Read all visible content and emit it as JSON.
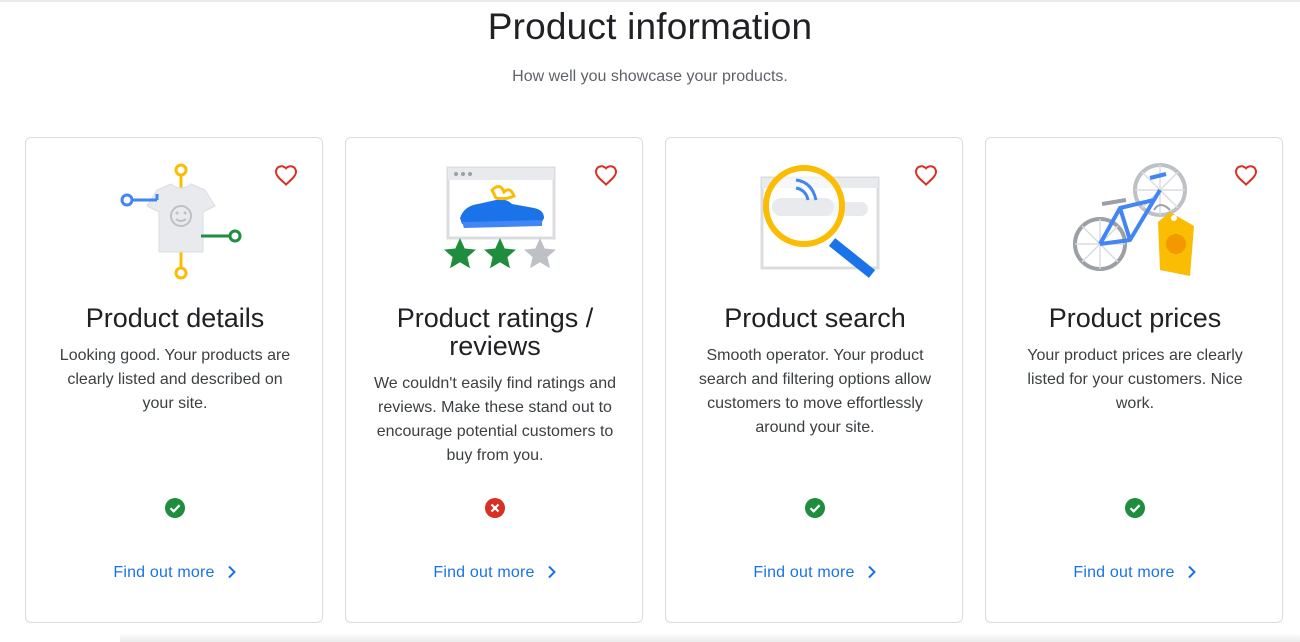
{
  "page": {
    "title": "Product information",
    "subtitle": "How well you showcase your products."
  },
  "colors": {
    "accent": "#1a73e8",
    "success": "#1e8e3e",
    "error": "#d93025",
    "heart": "#d93025"
  },
  "cards": [
    {
      "title": "Product details",
      "description": "Looking good. Your products are clearly listed and described on your site.",
      "status": "pass",
      "status_icon": "check-circle-icon",
      "illustration": "tshirt-icon",
      "link_label": "Find out more"
    },
    {
      "title": "Product ratings / reviews",
      "description": "We couldn't easily find ratings and reviews. Make these stand out to encourage potential customers to buy from you.",
      "status": "fail",
      "status_icon": "error-circle-icon",
      "illustration": "shoe-ratings-icon",
      "link_label": "Find out more"
    },
    {
      "title": "Product search",
      "description": "Smooth operator. Your product search and filtering options allow customers to move effortlessly around your site.",
      "status": "pass",
      "status_icon": "check-circle-icon",
      "illustration": "magnifier-icon",
      "link_label": "Find out more"
    },
    {
      "title": "Product prices",
      "description": "Your product prices are clearly listed for your customers. Nice work.",
      "status": "pass",
      "status_icon": "check-circle-icon",
      "illustration": "bicycle-price-tag-icon",
      "link_label": "Find out more"
    }
  ]
}
